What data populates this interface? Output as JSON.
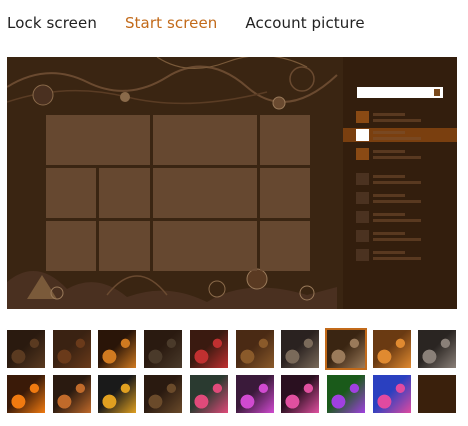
{
  "tabs": [
    {
      "label": "Lock screen",
      "active": false
    },
    {
      "label": "Start screen",
      "active": true
    },
    {
      "label": "Account picture",
      "active": false
    }
  ],
  "preview": {
    "background_color": "#3a2512",
    "tile_color": "#6a4b33",
    "accent_color": "#7a3f0f"
  },
  "colors": {
    "active_tab": "#c26a1a",
    "text": "#222222"
  },
  "thumbnails": {
    "row1": [
      {
        "name": "dark-brown-curves",
        "colors": [
          "#2a1a0f",
          "#5a3a20"
        ]
      },
      {
        "name": "brown-gradient",
        "colors": [
          "#3a2212",
          "#6a3a1a"
        ]
      },
      {
        "name": "orange-swirls",
        "colors": [
          "#2a1508",
          "#d07a20"
        ]
      },
      {
        "name": "dark-waves",
        "colors": [
          "#2a1a10",
          "#4a3a2a"
        ]
      },
      {
        "name": "red-circles",
        "colors": [
          "#3a1a10",
          "#c03030"
        ]
      },
      {
        "name": "brown-bands",
        "colors": [
          "#4a2a14",
          "#8a5a2a"
        ]
      },
      {
        "name": "gray-mechanical",
        "colors": [
          "#2a2220",
          "#7a6a5a"
        ]
      },
      {
        "name": "gear-motif-selected",
        "colors": [
          "#3a2512",
          "#9a7a5a"
        ]
      },
      {
        "name": "orange-triangles",
        "colors": [
          "#6a3a12",
          "#e08a30"
        ]
      },
      {
        "name": "gray-filigree",
        "colors": [
          "#2a2522",
          "#8a8078"
        ]
      }
    ],
    "row2": [
      {
        "name": "orange-cubes",
        "colors": [
          "#3a1a08",
          "#f07a10"
        ]
      },
      {
        "name": "drop-shapes",
        "colors": [
          "#2a1a10",
          "#c06a2a"
        ]
      },
      {
        "name": "colorful-dots",
        "colors": [
          "#1a1a1a",
          "#e0a020"
        ]
      },
      {
        "name": "dark-arcs",
        "colors": [
          "#2a1a10",
          "#6a4a2a"
        ]
      },
      {
        "name": "teal-pink",
        "colors": [
          "#2a3a30",
          "#e04a7a"
        ]
      },
      {
        "name": "purple-swirls",
        "colors": [
          "#3a1a3a",
          "#d04ad0"
        ]
      },
      {
        "name": "magenta-flowers",
        "colors": [
          "#2a1020",
          "#e050a0"
        ]
      },
      {
        "name": "green-kaleidoscope",
        "colors": [
          "#1a5a1a",
          "#a040e0"
        ]
      },
      {
        "name": "blue-droplets",
        "colors": [
          "#2a40c0",
          "#e04aa0"
        ]
      },
      {
        "name": "solid-dark",
        "colors": [
          "#3a200c",
          "#3a200c"
        ]
      }
    ]
  }
}
